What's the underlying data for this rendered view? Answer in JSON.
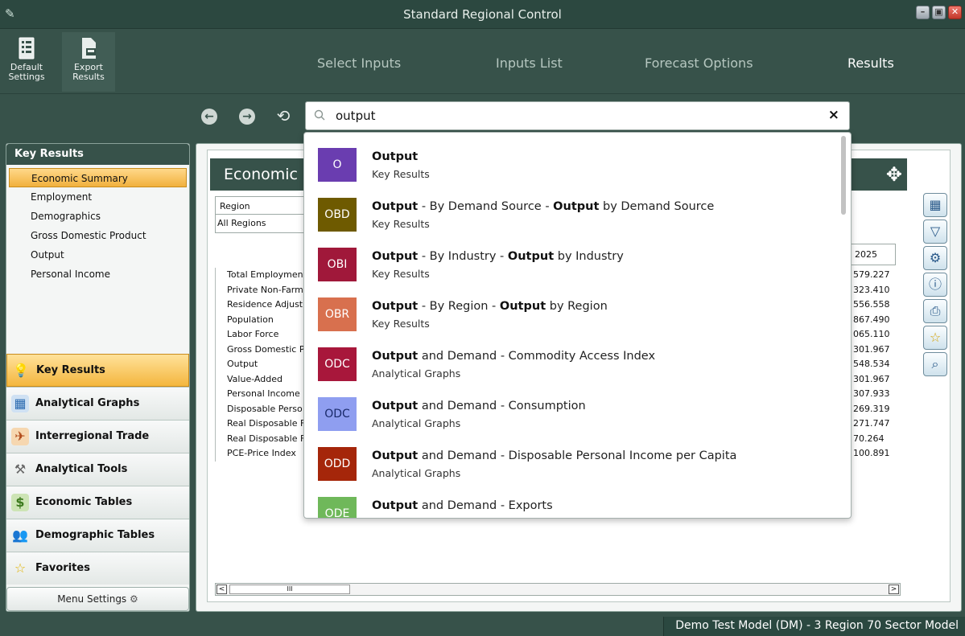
{
  "window": {
    "title": "Standard Regional Control",
    "controls": [
      "minimize",
      "restore",
      "close"
    ]
  },
  "ribbon": {
    "buttons": [
      {
        "label": "Default\nSettings",
        "icon": "default-settings-icon"
      },
      {
        "label": "Export\nResults",
        "icon": "export-icon"
      }
    ],
    "tabs": [
      "Select Inputs",
      "Inputs List",
      "Forecast Options",
      "Results"
    ],
    "active_tab": "Results"
  },
  "toolbar": {
    "back_icon": "←",
    "forward_icon": "→",
    "history_icon": "⟲"
  },
  "search": {
    "value": "output",
    "clear_icon": "×"
  },
  "left_panel": {
    "header": "Key Results",
    "items": [
      {
        "label": "Economic Summary",
        "selected": true
      },
      {
        "label": "Employment",
        "selected": false
      },
      {
        "label": "Demographics",
        "selected": false
      },
      {
        "label": "Gross Domestic Product",
        "selected": false
      },
      {
        "label": "Output",
        "selected": false
      },
      {
        "label": "Personal Income",
        "selected": false
      }
    ],
    "categories": [
      {
        "label": "Key Results",
        "active": true
      },
      {
        "label": "Analytical Graphs",
        "active": false
      },
      {
        "label": "Interregional Trade",
        "active": false
      },
      {
        "label": "Analytical Tools",
        "active": false
      },
      {
        "label": "Economic Tables",
        "active": false
      },
      {
        "label": "Demographic Tables",
        "active": false
      },
      {
        "label": "Favorites",
        "active": false
      }
    ],
    "menu_settings": "Menu Settings"
  },
  "report": {
    "title": "Economic",
    "region_label": "Region",
    "region_value": "All Regions",
    "rows": [
      "Total Employment",
      "Private Non-Farm",
      "Residence Adjust",
      "Population",
      "Labor Force",
      "Gross Domestic P",
      "Output",
      "Value-Added",
      "Personal Income",
      "Disposable Perso",
      "Real Disposable F",
      "Real Disposable F",
      "PCE-Price Index"
    ],
    "column_header": "2025",
    "values": [
      "579.227",
      "323.410",
      "556.558",
      "867.490",
      "065.110",
      "301.967",
      "548.534",
      "301.967",
      "307.933",
      "269.319",
      "271.747",
      "70.264",
      "100.891"
    ],
    "scroll_thumb_label": "III"
  },
  "dropdown": {
    "results": [
      {
        "badge": "O",
        "color": "#6a3db0",
        "bold": "Output",
        "rest": "",
        "category": "Key Results"
      },
      {
        "badge": "OBD",
        "color": "#6e5a00",
        "bold": "Output",
        "rest": " - By Demand Source - ",
        "bold2": "Output",
        "rest2": " by Demand Source",
        "category": "Key Results"
      },
      {
        "badge": "OBI",
        "color": "#a0183a",
        "bold": "Output",
        "rest": " - By Industry - ",
        "bold2": "Output",
        "rest2": " by Industry",
        "category": "Key Results"
      },
      {
        "badge": "OBR",
        "color": "#d8704e",
        "bold": "Output",
        "rest": " - By Region - ",
        "bold2": "Output",
        "rest2": " by Region",
        "category": "Key Results"
      },
      {
        "badge": "ODC",
        "color": "#a8173b",
        "bold": "Output",
        "rest": " and Demand - Commodity Access Index",
        "category": "Analytical Graphs"
      },
      {
        "badge": "ODC",
        "color": "#8f9ef0",
        "bold": "Output",
        "rest": " and Demand - Consumption",
        "category": "Analytical Graphs"
      },
      {
        "badge": "ODD",
        "color": "#a5260a",
        "bold": "Output",
        "rest": " and Demand - Disposable Personal Income per Capita",
        "category": "Analytical Graphs"
      },
      {
        "badge": "ODE",
        "color": "#6fb85a",
        "bold": "Output",
        "rest": " and Demand - Exports",
        "category": ""
      }
    ]
  },
  "status": {
    "text": "Demo Test Model (DM) -  3 Region 70 Sector Model"
  }
}
